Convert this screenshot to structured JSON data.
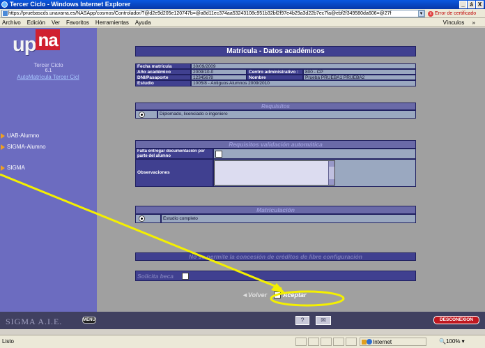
{
  "window": {
    "title": "Tercer Ciclo - Windows Internet Explorer",
    "minimize": "_",
    "restore": "á",
    "close": "X"
  },
  "address": {
    "url": "https://pruebascds.unavarra.es/NASApp/cosmos/Controlador/?@d2e9d205e120747b=@a8d11ec374aa53243108c951b32bf2f97e4b29a3d22b7ec7fa@ebf2f349580da606=@27f",
    "cert_error": "Error de certificado"
  },
  "menubar": {
    "items": [
      "Archivo",
      "Edición",
      "Ver",
      "Favoritos",
      "Herramientas",
      "Ayuda"
    ],
    "links": "Vínculos"
  },
  "sidebar": {
    "logo_up": "up",
    "logo_na": "na",
    "title": "Tercer Ciclo",
    "version": "6.1",
    "link": "AutoMatrícula Tercer Cicl",
    "nav": [
      "UAB-Alumno",
      "SIGMA-Alumno",
      "SIGMA"
    ]
  },
  "main": {
    "page_title": "Matrícula - Datos académicos",
    "info": {
      "fecha_label": "Fecha matrícula",
      "fecha_value": "30/09/2009",
      "anyo_label": "Año académico",
      "anyo_value": "2009/10-0",
      "centro_label": "Centro administrativo :",
      "centro_value": "800 - CP",
      "dni_label": "DNI/Pasaporte",
      "dni_value": "12345678",
      "nombre_label": "Nombre",
      "nombre_value": "Prueba PRUEBA1 PRUEBA2",
      "estudio_label": "Estudio",
      "estudio_value": "1005/8 - Antiguos Alumnos 2009/2010"
    },
    "requisitos": {
      "title": "Requisitos",
      "option": "Diplomado, licenciado o ingeniero"
    },
    "validacion": {
      "title": "Requisitos validación automática",
      "falta_label": "Falta entregar documentación por parte del alumno",
      "obs_label": "Observaciones"
    },
    "matriculacion": {
      "title": "Matriculación",
      "option": "Estudio completo"
    },
    "creditos_note": "No se permite la concesión de créditos de libre configuración",
    "beca_label": "Solicita beca",
    "back_label": "Volver",
    "accept_label": "Aceptar"
  },
  "footer": {
    "logo": "SIGMA A.I.E.",
    "menu": "MENU",
    "help": "?",
    "mail": "✉",
    "disconnect": "DESCONEXION"
  },
  "status": {
    "text": "Listo",
    "zone": "Internet",
    "zoom": "100%"
  },
  "colors": {
    "header_bg": "#404090",
    "sidebar_bg": "#6c6cc0",
    "content_bg": "#a0a0a0",
    "annotation": "#f4f000"
  }
}
